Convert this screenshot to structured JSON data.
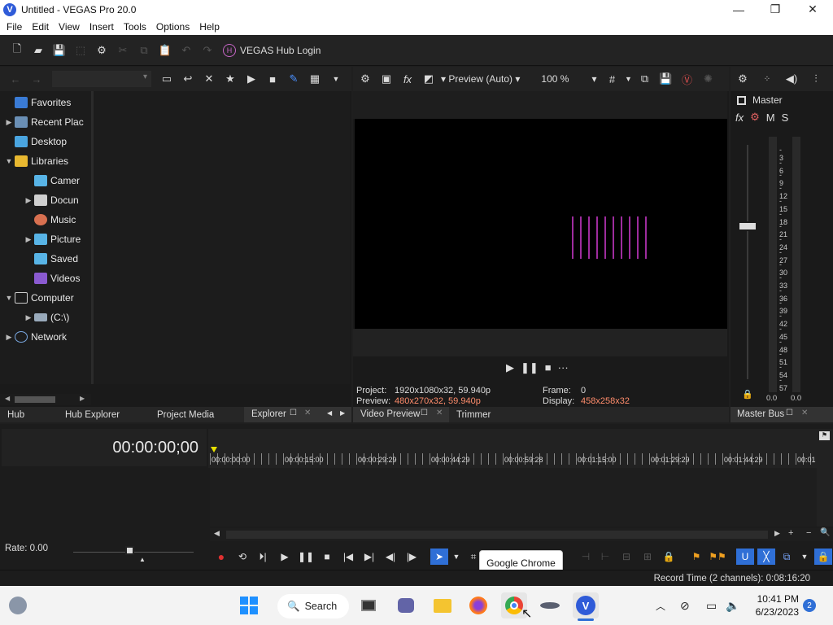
{
  "window": {
    "title": "Untitled - VEGAS Pro 20.0",
    "minimize": "—",
    "maximize": "❐",
    "close": "✕"
  },
  "menu": [
    "File",
    "Edit",
    "View",
    "Insert",
    "Tools",
    "Options",
    "Help"
  ],
  "toolbar": {
    "hub_login": "VEGAS Hub Login"
  },
  "explorer": {
    "tree": [
      {
        "label": "Favorites"
      },
      {
        "label": "Recent Plac"
      },
      {
        "label": "Desktop"
      },
      {
        "label": "Libraries"
      },
      {
        "label": "Camer"
      },
      {
        "label": "Docun"
      },
      {
        "label": "Music"
      },
      {
        "label": "Picture"
      },
      {
        "label": "Saved"
      },
      {
        "label": "Videos"
      },
      {
        "label": "Computer"
      },
      {
        "label": "(C:\\)"
      },
      {
        "label": "Network"
      }
    ]
  },
  "preview": {
    "mode": "Preview (Auto)",
    "zoom": "100 %",
    "project_label": "Project:",
    "project_value": "1920x1080x32, 59.940p",
    "preview_label": "Preview:",
    "preview_value": "480x270x32, 59.940p",
    "frame_label": "Frame:",
    "frame_value": "0",
    "display_label": "Display:",
    "display_value": "458x258x32"
  },
  "master": {
    "title": "Master",
    "m": "M",
    "s": "S",
    "scale": [
      "3",
      "6",
      "9",
      "12",
      "15",
      "18",
      "21",
      "24",
      "27",
      "30",
      "33",
      "36",
      "39",
      "42",
      "45",
      "48",
      "51",
      "54",
      "57"
    ],
    "left_value": "0.0",
    "right_value": "0.0"
  },
  "tabs": {
    "hub": "Hub",
    "hub_explorer": "Hub Explorer",
    "project_media": "Project Media",
    "explorer": "Explorer",
    "video_preview": "Video Preview",
    "trimmer": "Trimmer",
    "master_bus": "Master Bus"
  },
  "timeline": {
    "timecode": "00:00:00;00",
    "ruler": [
      "00:00:00:00",
      "00:00:15:00",
      "00:00:29:29",
      "00:00:44:29",
      "00:00:59:28",
      "00:01:15:00",
      "00:01:29:29",
      "00:01:44:29",
      "00:01"
    ],
    "rate": "Rate: 0.00",
    "record_time": "Record Time (2 channels): 0:08:16:20"
  },
  "tooltip": "Google Chrome",
  "taskbar": {
    "search": "Search",
    "time": "10:41 PM",
    "date": "6/23/2023",
    "badge": "2"
  },
  "colors": {
    "accent": "#2f6fd6",
    "orange_text": "#ff8c6b",
    "preview_lines": "#d23ad2"
  }
}
